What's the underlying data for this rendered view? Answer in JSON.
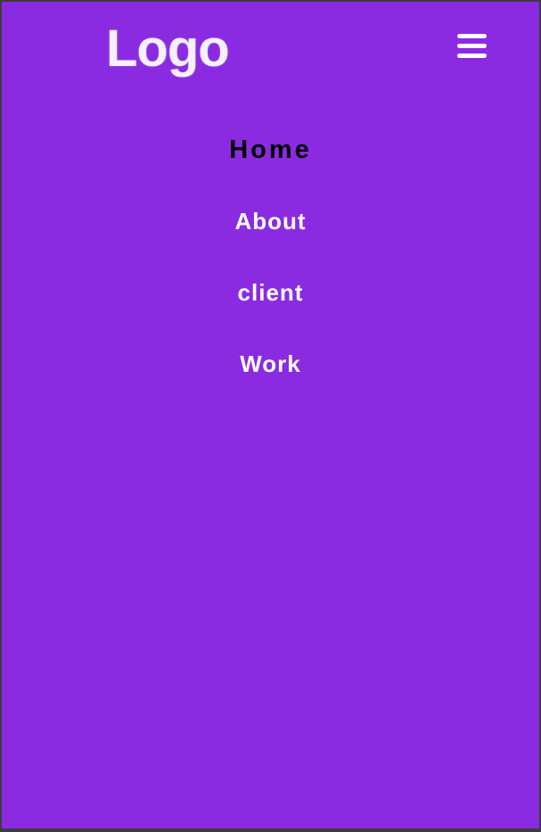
{
  "header": {
    "logo_text": "Logo",
    "menu_icon": "hamburger-menu-icon"
  },
  "nav": {
    "items": [
      {
        "label": "Home",
        "active": true
      },
      {
        "label": "About",
        "active": false
      },
      {
        "label": "client",
        "active": false
      },
      {
        "label": "Work",
        "active": false
      }
    ]
  },
  "colors": {
    "background": "#8a2be2",
    "frame": "#3c3c3c",
    "link": "#ffffff",
    "active_link": "#000000"
  }
}
